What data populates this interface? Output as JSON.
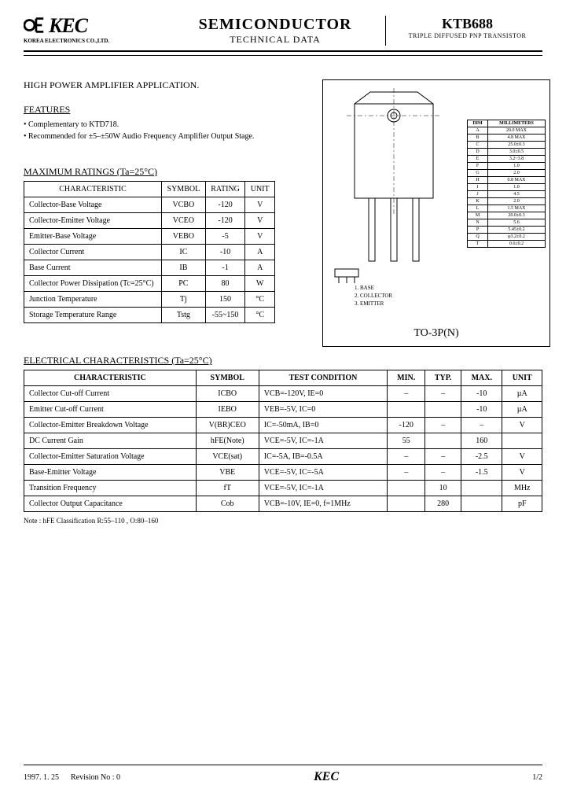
{
  "header": {
    "company_logo_text": "KEC",
    "company_subtitle": "KOREA ELECTRONICS CO.,LTD.",
    "center_main": "SEMICONDUCTOR",
    "center_sub": "TECHNICAL DATA",
    "part_number": "KTB688",
    "part_desc": "TRIPLE DIFFUSED PNP TRANSISTOR"
  },
  "application_title": "HIGH POWER AMPLIFIER APPLICATION.",
  "features": {
    "heading": "FEATURES",
    "items": [
      "Complementary to KTD718.",
      "Recommended for ±5–±50W Audio Frequency Amplifier Output Stage."
    ]
  },
  "ratings": {
    "heading": "MAXIMUM RATINGS (Ta=25°C)",
    "cols": [
      "CHARACTERISTIC",
      "SYMBOL",
      "RATING",
      "UNIT"
    ],
    "rows": [
      [
        "Collector-Base Voltage",
        "VCBO",
        "-120",
        "V"
      ],
      [
        "Collector-Emitter Voltage",
        "VCEO",
        "-120",
        "V"
      ],
      [
        "Emitter-Base Voltage",
        "VEBO",
        "-5",
        "V"
      ],
      [
        "Collector Current",
        "IC",
        "-10",
        "A"
      ],
      [
        "Base Current",
        "IB",
        "-1",
        "A"
      ],
      [
        "Collector Power Dissipation (Tc=25°C)",
        "PC",
        "80",
        "W"
      ],
      [
        "Junction Temperature",
        "Tj",
        "150",
        "°C"
      ],
      [
        "Storage Temperature Range",
        "Tstg",
        "-55~150",
        "°C"
      ]
    ]
  },
  "package": {
    "label": "TO-3P(N)",
    "dim_header": [
      "DIM",
      "MILLIMETERS"
    ],
    "dims": [
      [
        "A",
        "20.0 MAX"
      ],
      [
        "B",
        "4.8 MAX"
      ],
      [
        "C",
        "25.0±0.3"
      ],
      [
        "D",
        "3.0±0.5"
      ],
      [
        "E",
        "3.2~3.8"
      ],
      [
        "F",
        "1.0"
      ],
      [
        "G",
        "2.0"
      ],
      [
        "H",
        "0.8 MAX"
      ],
      [
        "I",
        "1.0"
      ],
      [
        "J",
        "4.5"
      ],
      [
        "K",
        "2.0"
      ],
      [
        "L",
        "1.5 MAX"
      ],
      [
        "M",
        "20.0±0.3"
      ],
      [
        "N",
        "5.6"
      ],
      [
        "P",
        "5.45±0.2"
      ],
      [
        "Q",
        "φ3.2±0.2"
      ],
      [
        "T",
        "0.6±0.2"
      ]
    ],
    "pins": [
      "1. BASE",
      "2. COLLECTOR",
      "3. EMITTER"
    ]
  },
  "electrical": {
    "heading": "ELECTRICAL CHARACTERISTICS (Ta=25°C)",
    "cols": [
      "CHARACTERISTIC",
      "SYMBOL",
      "TEST CONDITION",
      "MIN.",
      "TYP.",
      "MAX.",
      "UNIT"
    ],
    "rows": [
      [
        "Collector Cut-off Current",
        "ICBO",
        "VCB=-120V, IE=0",
        "–",
        "–",
        "-10",
        "µA"
      ],
      [
        "Emitter Cut-off Current",
        "IEBO",
        "VEB=-5V, IC=0",
        "",
        "",
        "-10",
        "µA"
      ],
      [
        "Collector-Emitter Breakdown Voltage",
        "V(BR)CEO",
        "IC=-50mA, IB=0",
        "-120",
        "–",
        "–",
        "V"
      ],
      [
        "DC Current Gain",
        "hFE(Note)",
        "VCE=-5V, IC=-1A",
        "55",
        "",
        "160",
        ""
      ],
      [
        "Collector-Emitter Saturation Voltage",
        "VCE(sat)",
        "IC=-5A, IB=-0.5A",
        "–",
        "–",
        "-2.5",
        "V"
      ],
      [
        "Base-Emitter Voltage",
        "VBE",
        "VCE=-5V, IC=-5A",
        "–",
        "–",
        "-1.5",
        "V"
      ],
      [
        "Transition Frequency",
        "fT",
        "VCE=-5V, IC=-1A",
        "",
        "10",
        "",
        "MHz"
      ],
      [
        "Collector Output Capacitance",
        "Cob",
        "VCB=-10V, IE=0, f=1MHz",
        "",
        "280",
        "",
        "pF"
      ]
    ],
    "note": "Note : hFE Classification   R:55–110 ,  O:80–160"
  },
  "footer": {
    "date": "1997. 1. 25",
    "revision": "Revision No : 0",
    "logo": "KEC",
    "page": "1/2"
  }
}
